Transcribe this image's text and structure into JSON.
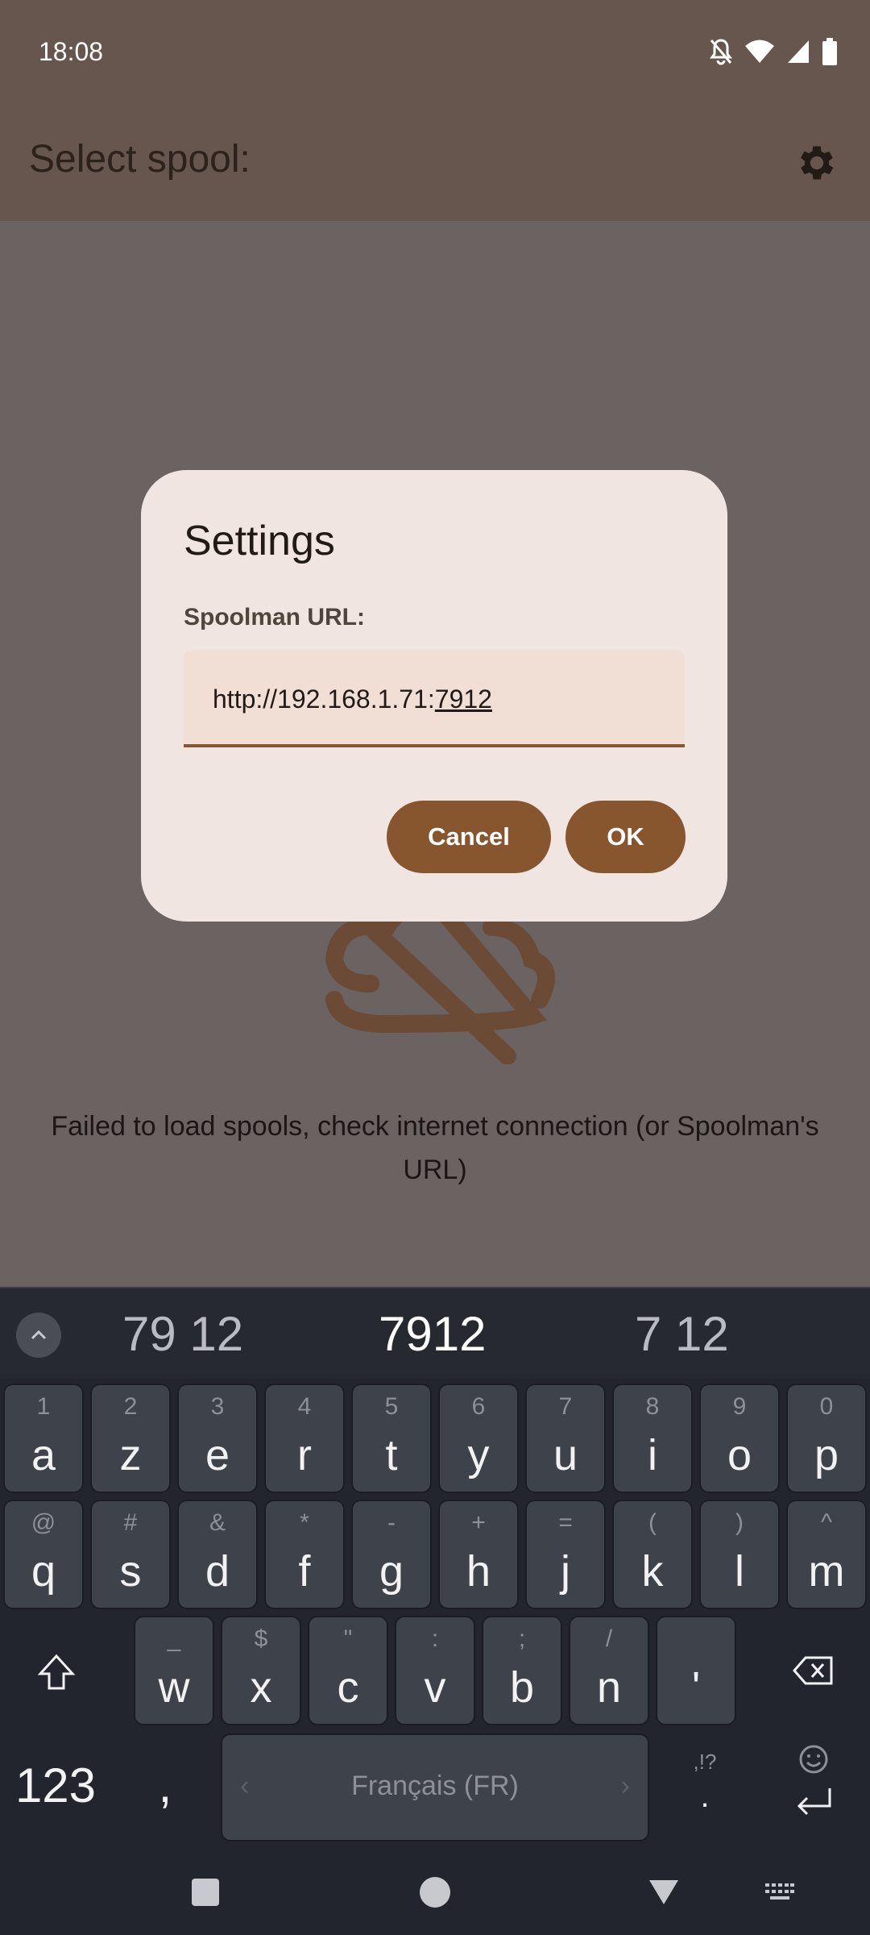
{
  "status_bar": {
    "time": "18:08"
  },
  "app_bar": {
    "title": "Select spool:"
  },
  "error": {
    "message": "Failed to load spools, check internet connection (or Spoolman's URL)"
  },
  "dialog": {
    "title": "Settings",
    "url_label": "Spoolman URL:",
    "url_value_prefix": "http://192.168.1.71:",
    "url_value_composing": "7912",
    "cancel_label": "Cancel",
    "ok_label": "OK"
  },
  "keyboard": {
    "suggestions": [
      "79 12",
      "7912",
      "7 12"
    ],
    "row1": [
      {
        "hint": "1",
        "key": "a"
      },
      {
        "hint": "2",
        "key": "z"
      },
      {
        "hint": "3",
        "key": "e"
      },
      {
        "hint": "4",
        "key": "r"
      },
      {
        "hint": "5",
        "key": "t"
      },
      {
        "hint": "6",
        "key": "y"
      },
      {
        "hint": "7",
        "key": "u"
      },
      {
        "hint": "8",
        "key": "i"
      },
      {
        "hint": "9",
        "key": "o"
      },
      {
        "hint": "0",
        "key": "p"
      }
    ],
    "row2": [
      {
        "hint": "@",
        "key": "q"
      },
      {
        "hint": "#",
        "key": "s"
      },
      {
        "hint": "&",
        "key": "d"
      },
      {
        "hint": "*",
        "key": "f"
      },
      {
        "hint": "-",
        "key": "g"
      },
      {
        "hint": "+",
        "key": "h"
      },
      {
        "hint": "=",
        "key": "j"
      },
      {
        "hint": "(",
        "key": "k"
      },
      {
        "hint": ")",
        "key": "l"
      },
      {
        "hint": "^",
        "key": "m"
      }
    ],
    "row3": [
      {
        "hint": "_",
        "key": "w"
      },
      {
        "hint": "$",
        "key": "x"
      },
      {
        "hint": "\"",
        "key": "c"
      },
      {
        "hint": ":",
        "key": "v"
      },
      {
        "hint": ";",
        "key": "b"
      },
      {
        "hint": "/",
        "key": "n"
      },
      {
        "hint": "",
        "key": "'"
      }
    ],
    "numbers_key": "123",
    "comma_key": ",",
    "space_label": "Français (FR)",
    "punct_hint": ",!?",
    "period_key": "."
  },
  "icons": {
    "settings": "gear-icon",
    "cloud_off": "cloud-off-icon",
    "shift": "shift-icon",
    "backspace": "backspace-icon",
    "enter": "enter-icon",
    "emoji": "emoji-icon"
  },
  "colors": {
    "accent": "#87562f",
    "dialog_bg": "#f0e5e0",
    "scrim_bg": "#6a6362",
    "keyboard_bg": "#22252e"
  }
}
